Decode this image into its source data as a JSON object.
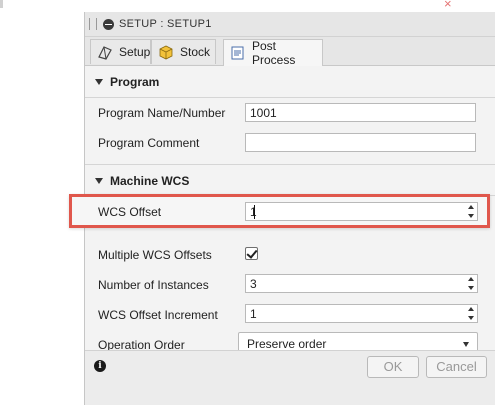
{
  "dialog": {
    "title": "SETUP : SETUP1",
    "icons": {
      "collapse": "minus-circle-icon",
      "grip": "drag-grip-icon"
    }
  },
  "tabs": [
    {
      "label": "Setup",
      "icon": "setup-axis-icon"
    },
    {
      "label": "Stock",
      "icon": "stock-box-icon"
    },
    {
      "label": "Post Process",
      "icon": "post-process-icon",
      "active": true
    }
  ],
  "program": {
    "header": "Program",
    "name_label": "Program Name/Number",
    "name_value": "1001",
    "comment_label": "Program Comment",
    "comment_value": ""
  },
  "machine_wcs": {
    "header": "Machine WCS",
    "wcs_offset_label": "WCS Offset",
    "wcs_offset_value": "1",
    "multiple_label": "Multiple WCS Offsets",
    "multiple_checked": true,
    "instances_label": "Number of Instances",
    "instances_value": "3",
    "increment_label": "WCS Offset Increment",
    "increment_value": "1",
    "order_label": "Operation Order",
    "order_value": "Preserve order"
  },
  "footer": {
    "ok_label": "OK",
    "cancel_label": "Cancel",
    "info_icon": "info-icon"
  },
  "colors": {
    "highlight": "#e0574c",
    "panel": "#f3f3f3"
  }
}
